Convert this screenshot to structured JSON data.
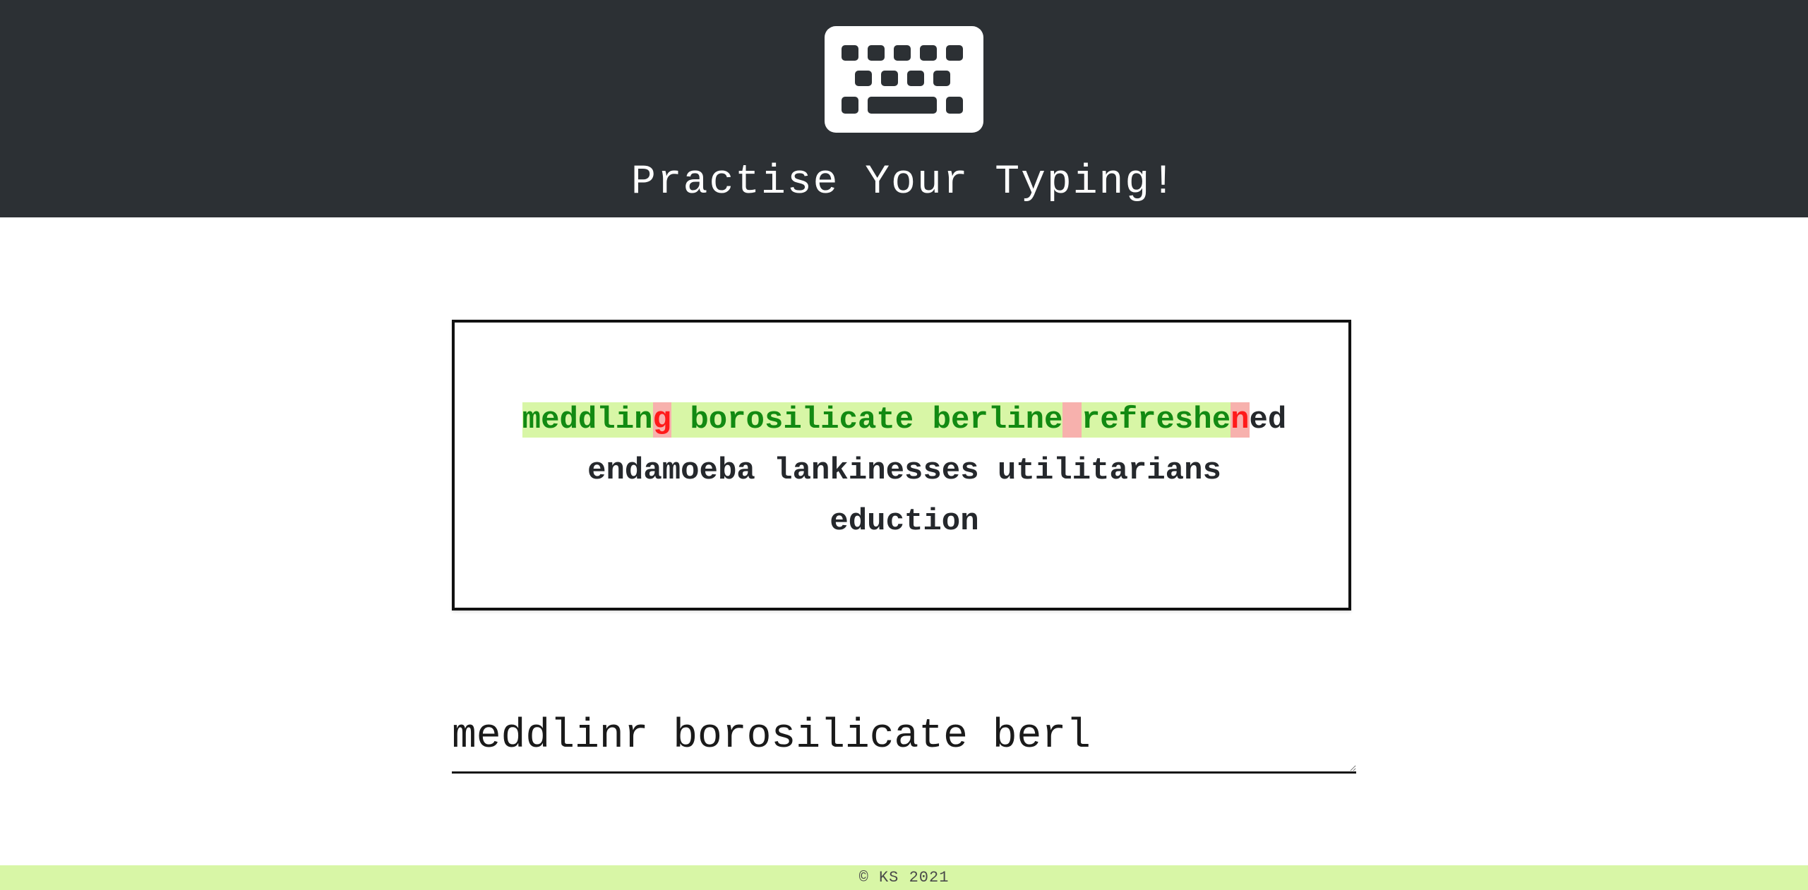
{
  "header": {
    "icon": "keyboard-icon",
    "title": "Practise Your Typing!",
    "background_color": "#2c3034"
  },
  "target": {
    "lines": [
      [
        {
          "ch": "m",
          "state": "ok"
        },
        {
          "ch": "e",
          "state": "ok"
        },
        {
          "ch": "d",
          "state": "ok"
        },
        {
          "ch": "d",
          "state": "ok"
        },
        {
          "ch": "l",
          "state": "ok"
        },
        {
          "ch": "i",
          "state": "ok"
        },
        {
          "ch": "n",
          "state": "ok"
        },
        {
          "ch": "g",
          "state": "bad"
        },
        {
          "ch": " ",
          "state": "ok"
        },
        {
          "ch": "b",
          "state": "ok"
        },
        {
          "ch": "o",
          "state": "ok"
        },
        {
          "ch": "r",
          "state": "ok"
        },
        {
          "ch": "o",
          "state": "ok"
        },
        {
          "ch": "s",
          "state": "ok"
        },
        {
          "ch": "i",
          "state": "ok"
        },
        {
          "ch": "l",
          "state": "ok"
        },
        {
          "ch": "i",
          "state": "ok"
        },
        {
          "ch": "c",
          "state": "ok"
        },
        {
          "ch": "a",
          "state": "ok"
        },
        {
          "ch": "t",
          "state": "ok"
        },
        {
          "ch": "e",
          "state": "ok"
        },
        {
          "ch": " ",
          "state": "ok"
        },
        {
          "ch": "b",
          "state": "ok"
        },
        {
          "ch": "e",
          "state": "ok"
        },
        {
          "ch": "r",
          "state": "ok"
        },
        {
          "ch": "l",
          "state": "ok"
        },
        {
          "ch": "i",
          "state": "ok"
        },
        {
          "ch": "n",
          "state": "ok"
        },
        {
          "ch": "e",
          "state": "ok"
        },
        {
          "ch": " ",
          "state": "bad"
        },
        {
          "ch": "r",
          "state": "ok"
        },
        {
          "ch": "e",
          "state": "ok"
        },
        {
          "ch": "f",
          "state": "ok"
        },
        {
          "ch": "r",
          "state": "ok"
        },
        {
          "ch": "e",
          "state": "ok"
        },
        {
          "ch": "s",
          "state": "ok"
        },
        {
          "ch": "h",
          "state": "ok"
        },
        {
          "ch": "e",
          "state": "ok"
        },
        {
          "ch": "n",
          "state": "bad"
        },
        {
          "ch": "e",
          "state": "pending"
        },
        {
          "ch": "d",
          "state": "pending"
        }
      ],
      [
        {
          "ch": "endamoeba lankinesses utilitarians",
          "state": "pending"
        }
      ],
      [
        {
          "ch": "eduction",
          "state": "pending"
        }
      ]
    ],
    "correct_bg": "#d8f6a6",
    "correct_fg": "#128a12",
    "error_bg": "#f7b1ad",
    "error_fg": "#ff1a1a"
  },
  "input": {
    "value": "meddlinr borosilicate berl"
  },
  "footer": {
    "text": "© KS 2021",
    "background_color": "#d8f6a6"
  }
}
